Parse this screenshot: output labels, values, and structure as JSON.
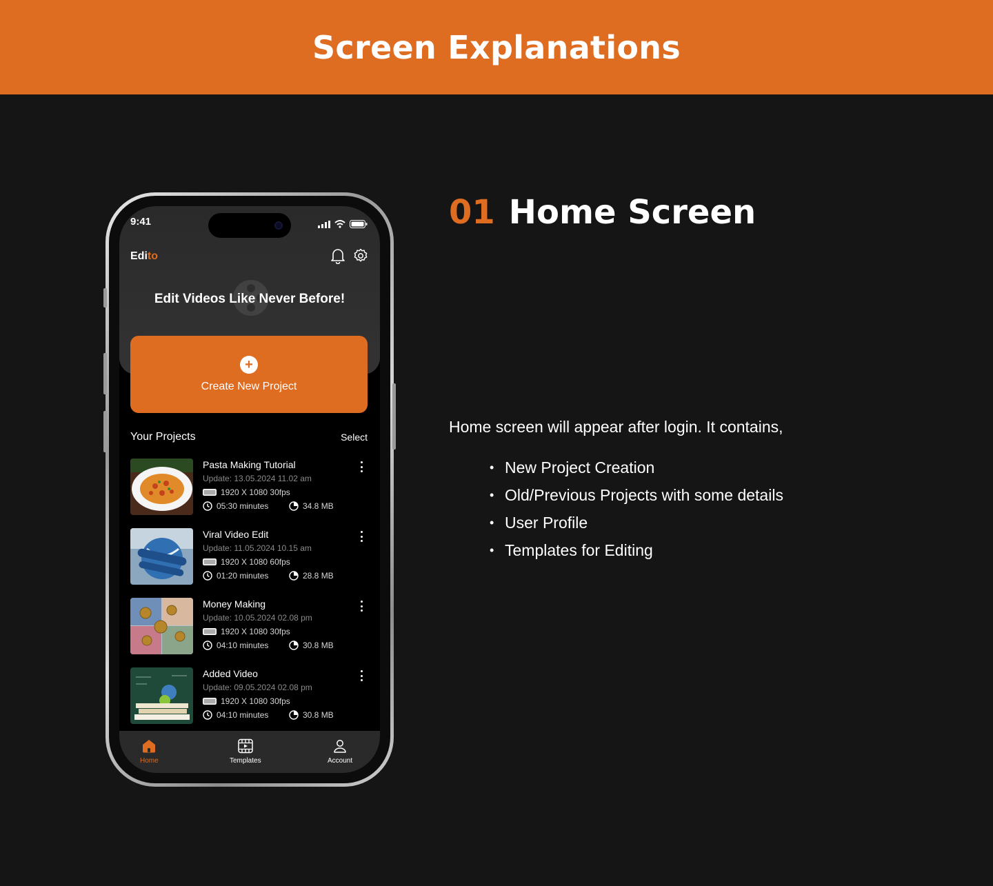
{
  "banner": {
    "title": "Screen Explanations"
  },
  "section": {
    "number": "01",
    "title": "Home Screen",
    "intro": "Home screen will appear after login. It contains,",
    "bullets": [
      "New Project Creation",
      "Old/Previous Projects with some details",
      "User Profile",
      "Templates for Editing"
    ]
  },
  "app": {
    "status": {
      "time": "9:41"
    },
    "brand": {
      "prefix": "Edi",
      "accent": "to"
    },
    "tagline": "Edit Videos Like Never Before!",
    "create_button": "Create New Project",
    "projects_header": {
      "title": "Your Projects",
      "action": "Select"
    },
    "projects": [
      {
        "title": "Pasta Making Tutorial",
        "update": "Update: 13.05.2024  11.02 am",
        "resolution": "1920 X 1080  30fps",
        "duration": "05:30 minutes",
        "size": "34.8 MB",
        "thumb": "pasta"
      },
      {
        "title": "Viral Video Edit",
        "update": "Update: 11.05.2024  10.15 am",
        "resolution": "1920 X 1080  60fps",
        "duration": "01:20 minutes",
        "size": "28.8 MB",
        "thumb": "globe"
      },
      {
        "title": "Money Making",
        "update": "Update: 10.05.2024  02.08 pm",
        "resolution": "1920 X 1080  30fps",
        "duration": "04:10 minutes",
        "size": "30.8 MB",
        "thumb": "money"
      },
      {
        "title": "Added Video",
        "update": "Update: 09.05.2024  02.08 pm",
        "resolution": "1920 X 1080  30fps",
        "duration": "04:10 minutes",
        "size": "30.8 MB",
        "thumb": "books"
      }
    ],
    "tabs": [
      {
        "label": "Home",
        "icon": "home-icon",
        "active": true
      },
      {
        "label": "Templates",
        "icon": "film-icon",
        "active": false
      },
      {
        "label": "Account",
        "icon": "user-icon",
        "active": false
      }
    ]
  },
  "colors": {
    "accent": "#DE6C21",
    "background": "#151515"
  }
}
